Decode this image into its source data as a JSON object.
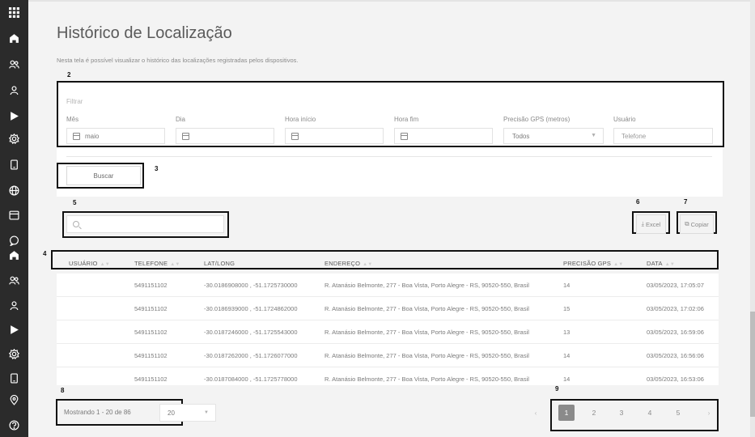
{
  "page": {
    "title": "Histórico de Localização",
    "description": "Nesta tela é possível visualizar o histórico das localizações registradas pelos dispositivos."
  },
  "sidebar": {
    "icons": [
      "apps-grid-icon",
      "home-icon",
      "users-icon",
      "user-icon",
      "play-icon",
      "settings-icon",
      "tablet-icon",
      "globe-icon",
      "calendar-icon",
      "chat-icon",
      "home-icon",
      "users-icon",
      "user-icon",
      "play-icon",
      "settings-icon",
      "tablet-icon",
      "location-pin-icon",
      "help-icon"
    ]
  },
  "markers": [
    "2",
    "3",
    "4",
    "5",
    "6",
    "7",
    "8",
    "9"
  ],
  "filters": {
    "heading": "Filtrar",
    "month": {
      "label": "Mês",
      "value": "maio"
    },
    "day": {
      "label": "Dia",
      "value": ""
    },
    "start_hour": {
      "label": "Hora início",
      "value": ""
    },
    "end_hour": {
      "label": "Hora fim",
      "value": ""
    },
    "gps_precision": {
      "label": "Precisão GPS (metros)",
      "value": "Todos"
    },
    "user": {
      "label": "Usuário",
      "placeholder": "Telefone"
    },
    "search_button": "Buscar"
  },
  "toolbar": {
    "search_placeholder": "",
    "excel_label": "Excel",
    "copy_label": "Copiar"
  },
  "table": {
    "headers": [
      "USUÁRIO",
      "TELEFONE",
      "LAT/LONG",
      "ENDEREÇO",
      "PRECISÃO GPS",
      "DATA"
    ],
    "rows": [
      {
        "usuario": "",
        "telefone": "5491151102",
        "latlong": "-30.0186908000 , -51.1725730000",
        "endereco": "R. Atanásio Belmonte, 277 - Boa Vista, Porto Alegre - RS, 90520-550, Brasil",
        "precisao": "14",
        "data": "03/05/2023, 17:05:07"
      },
      {
        "usuario": "",
        "telefone": "5491151102",
        "latlong": "-30.0186939000 , -51.1724862000",
        "endereco": "R. Atanásio Belmonte, 277 - Boa Vista, Porto Alegre - RS, 90520-550, Brasil",
        "precisao": "15",
        "data": "03/05/2023, 17:02:06"
      },
      {
        "usuario": "",
        "telefone": "5491151102",
        "latlong": "-30.0187246000 , -51.1725543000",
        "endereco": "R. Atanásio Belmonte, 277 - Boa Vista, Porto Alegre - RS, 90520-550, Brasil",
        "precisao": "13",
        "data": "03/05/2023, 16:59:06"
      },
      {
        "usuario": "",
        "telefone": "5491151102",
        "latlong": "-30.0187262000 , -51.1726077000",
        "endereco": "R. Atanásio Belmonte, 277 - Boa Vista, Porto Alegre - RS, 90520-550, Brasil",
        "precisao": "14",
        "data": "03/05/2023, 16:56:06"
      },
      {
        "usuario": "",
        "telefone": "5491151102",
        "latlong": "-30.0187084000 , -51.1725778000",
        "endereco": "R. Atanásio Belmonte, 277 - Boa Vista, Porto Alegre - RS, 90520-550, Brasil",
        "precisao": "14",
        "data": "03/05/2023, 16:53:06"
      }
    ]
  },
  "pagination": {
    "info": "Mostrando 1 - 20 de 86",
    "page_size": "20",
    "prev": "‹",
    "pages": [
      "1",
      "2",
      "3",
      "4",
      "5"
    ],
    "next": "›"
  }
}
